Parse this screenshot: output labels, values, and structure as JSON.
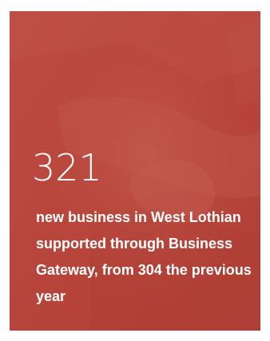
{
  "stat": {
    "number": "321",
    "description": "new business in West Lothian supported through Business Gateway, from 304 the previous year"
  },
  "colors": {
    "card_base": "#b5483f",
    "overlay": "rgba(185, 62, 52, 0.45)",
    "text": "#ffffff"
  },
  "background_image": "handshake-photo"
}
